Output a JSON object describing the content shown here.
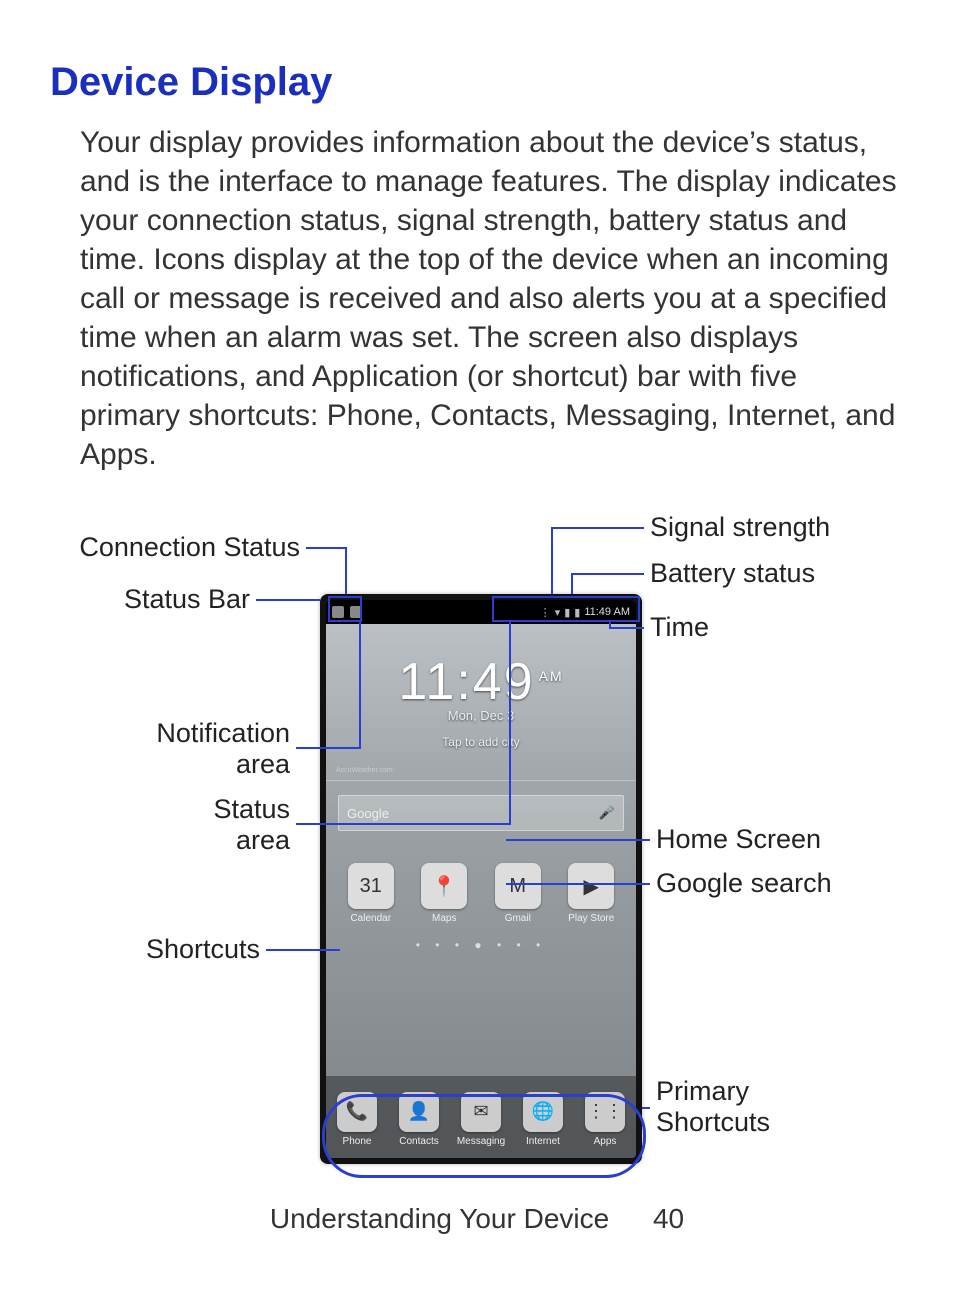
{
  "heading": "Device Display",
  "paragraph": "Your display provides information about the device’s status, and is the interface to manage features. The display indicates your connection status, signal strength, battery status and time. Icons display at the top of the device when an incoming call or message is received and also alerts you at a specified time when an alarm was set. The screen also displays notifications, and Application (or shortcut) bar with five primary shortcuts: Phone, Contacts, Messaging, Internet, and Apps.",
  "callouts": {
    "connection_status": "Connection Status",
    "status_bar": "Status Bar",
    "notification_area_l1": "Notification",
    "notification_area_l2": "area",
    "status_area_l1": "Status",
    "status_area_l2": "area",
    "shortcuts": "Shortcuts",
    "signal_strength": "Signal strength",
    "battery_status": "Battery status",
    "time": "Time",
    "home_screen": "Home Screen",
    "google_search": "Google search",
    "primary_shortcuts_l1": "Primary",
    "primary_shortcuts_l2": "Shortcuts"
  },
  "phone": {
    "status_bar_time": "11:49 AM",
    "clock_time": "11:49",
    "clock_ampm": "AM",
    "clock_date": "Mon, Dec 3",
    "clock_tap": "Tap to add city",
    "accuweather": "AccuWeather.com",
    "search_placeholder": "Google",
    "apps": [
      {
        "label": "Calendar",
        "glyph": "31"
      },
      {
        "label": "Maps",
        "glyph": "📍"
      },
      {
        "label": "Gmail",
        "glyph": "M"
      },
      {
        "label": "Play Store",
        "glyph": "▶"
      }
    ],
    "dock": [
      {
        "label": "Phone",
        "glyph": "📞"
      },
      {
        "label": "Contacts",
        "glyph": "👤"
      },
      {
        "label": "Messaging",
        "glyph": "✉"
      },
      {
        "label": "Internet",
        "glyph": "🌐"
      },
      {
        "label": "Apps",
        "glyph": "⋮⋮"
      }
    ]
  },
  "footer": {
    "section": "Understanding Your Device",
    "page": "40"
  }
}
